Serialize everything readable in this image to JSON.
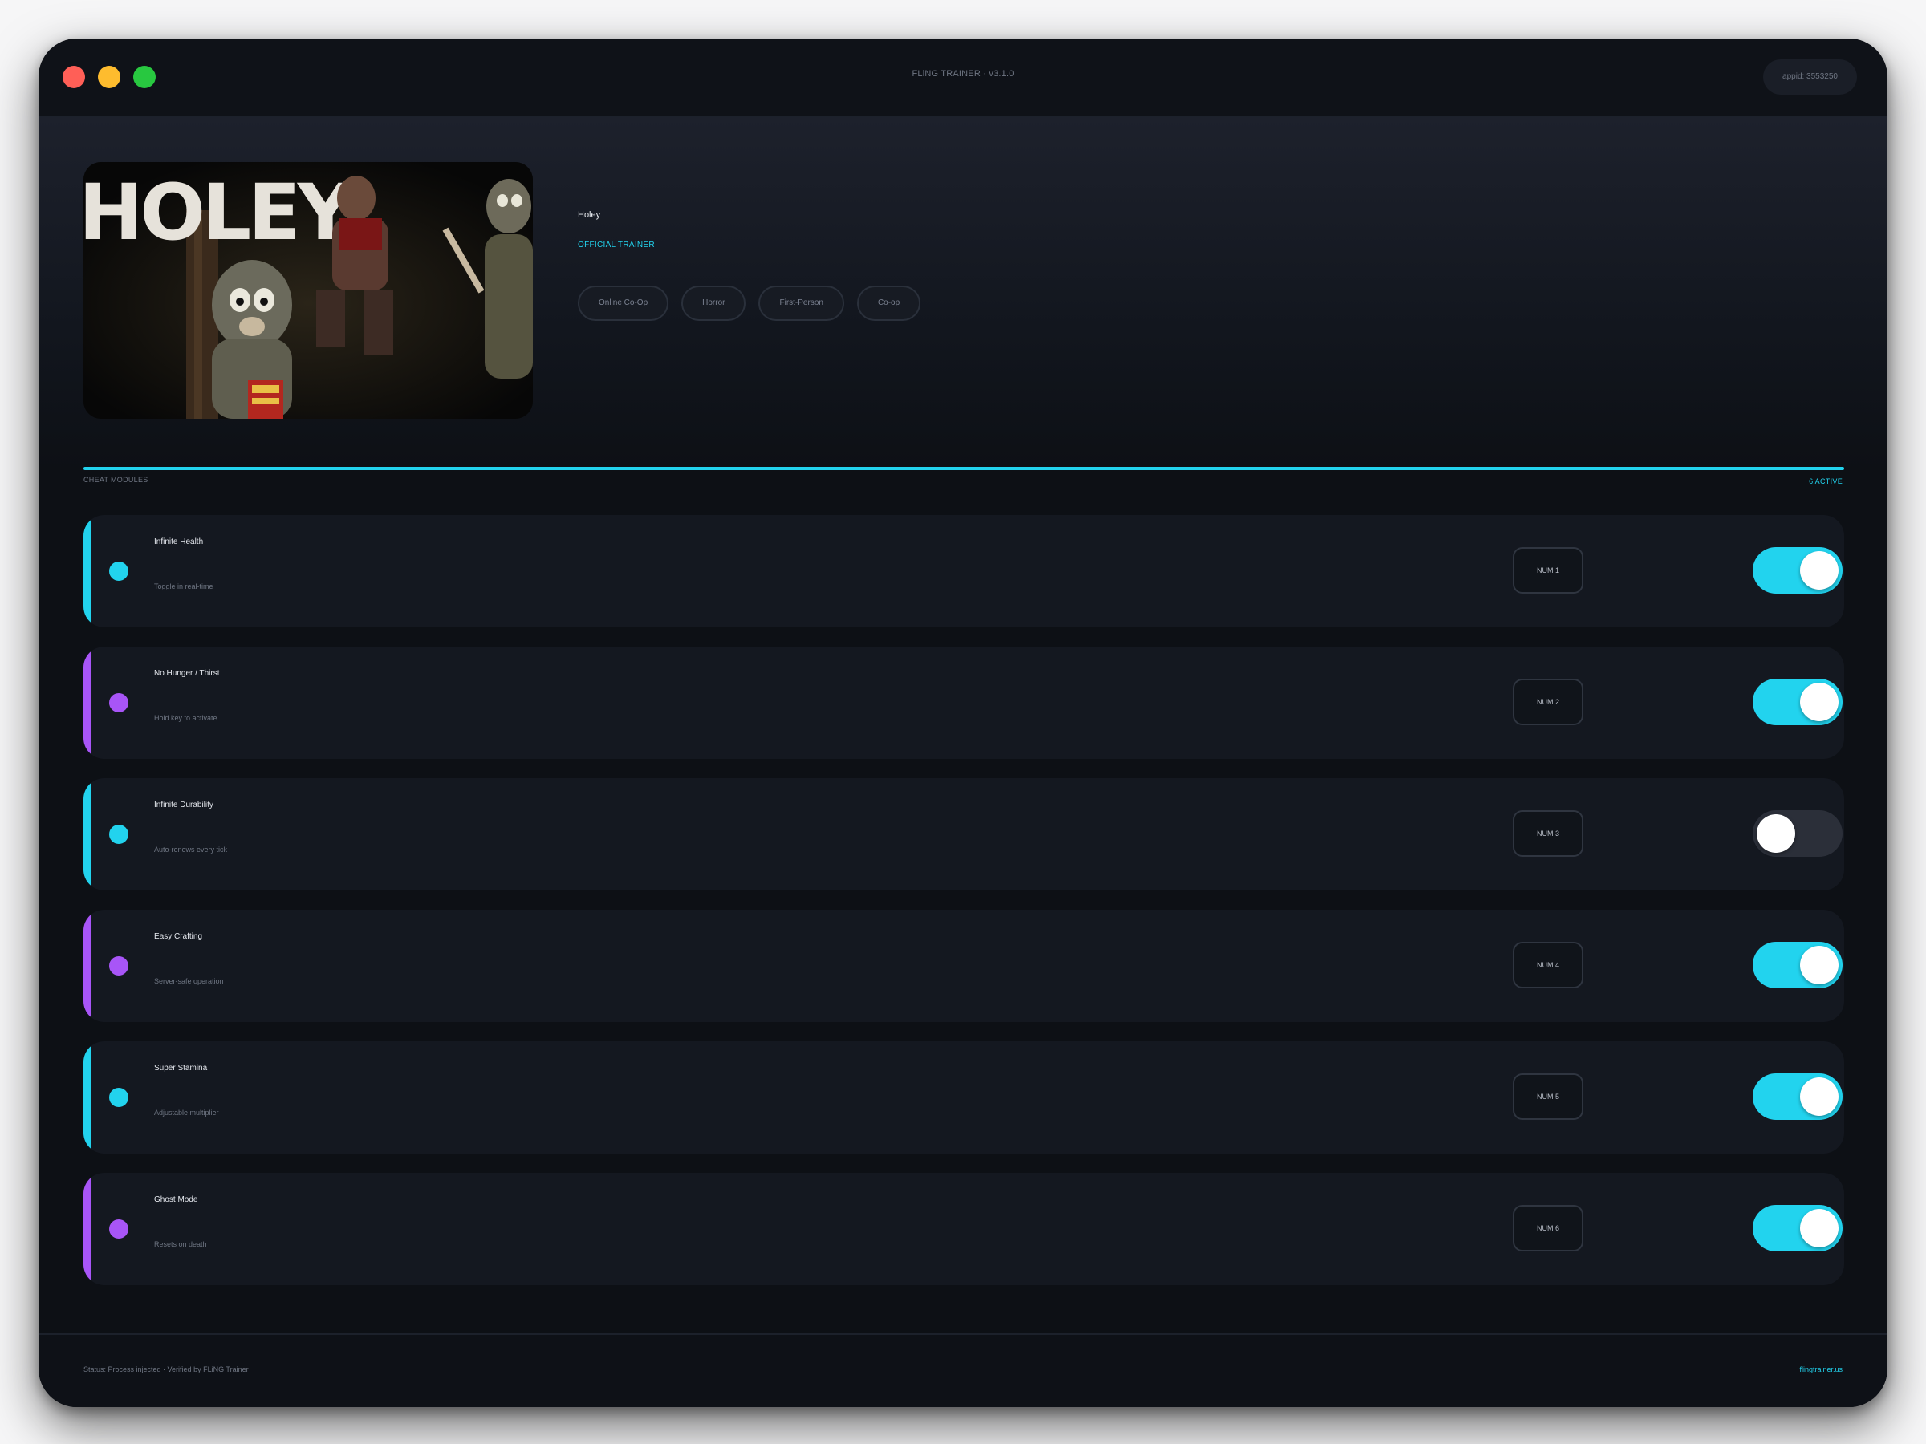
{
  "window": {
    "title": "FLiNG TRAINER · v3.1.0",
    "appid": "appid: 3553250"
  },
  "game": {
    "title": "Holey",
    "badge": "OFFICIAL TRAINER",
    "cover_logo_text": "HOLEY",
    "tags": [
      "Online Co-Op",
      "Horror",
      "First-Person",
      "Co-op"
    ]
  },
  "section": {
    "label": "CHEAT MODULES",
    "active_count": "6 ACTIVE"
  },
  "colors": {
    "accent_cyan": "#22d3ee",
    "accent_purple": "#a855f7",
    "toggle_off": "#2b2f39"
  },
  "modules": [
    {
      "name": "Infinite Health",
      "subtitle": "Toggle in real-time",
      "hotkey": "NUM 1",
      "enabled": true,
      "accent": "cyan"
    },
    {
      "name": "No Hunger / Thirst",
      "subtitle": "Hold key to activate",
      "hotkey": "NUM 2",
      "enabled": true,
      "accent": "purple"
    },
    {
      "name": "Infinite Durability",
      "subtitle": "Auto-renews every tick",
      "hotkey": "NUM 3",
      "enabled": false,
      "accent": "cyan"
    },
    {
      "name": "Easy Crafting",
      "subtitle": "Server-safe operation",
      "hotkey": "NUM 4",
      "enabled": true,
      "accent": "purple"
    },
    {
      "name": "Super Stamina",
      "subtitle": "Adjustable multiplier",
      "hotkey": "NUM 5",
      "enabled": true,
      "accent": "cyan"
    },
    {
      "name": "Ghost Mode",
      "subtitle": "Resets on death",
      "hotkey": "NUM 6",
      "enabled": true,
      "accent": "purple"
    }
  ],
  "footer": {
    "status": "Status: Process injected · Verified by FLiNG Trainer",
    "site": "flingtrainer.us"
  }
}
